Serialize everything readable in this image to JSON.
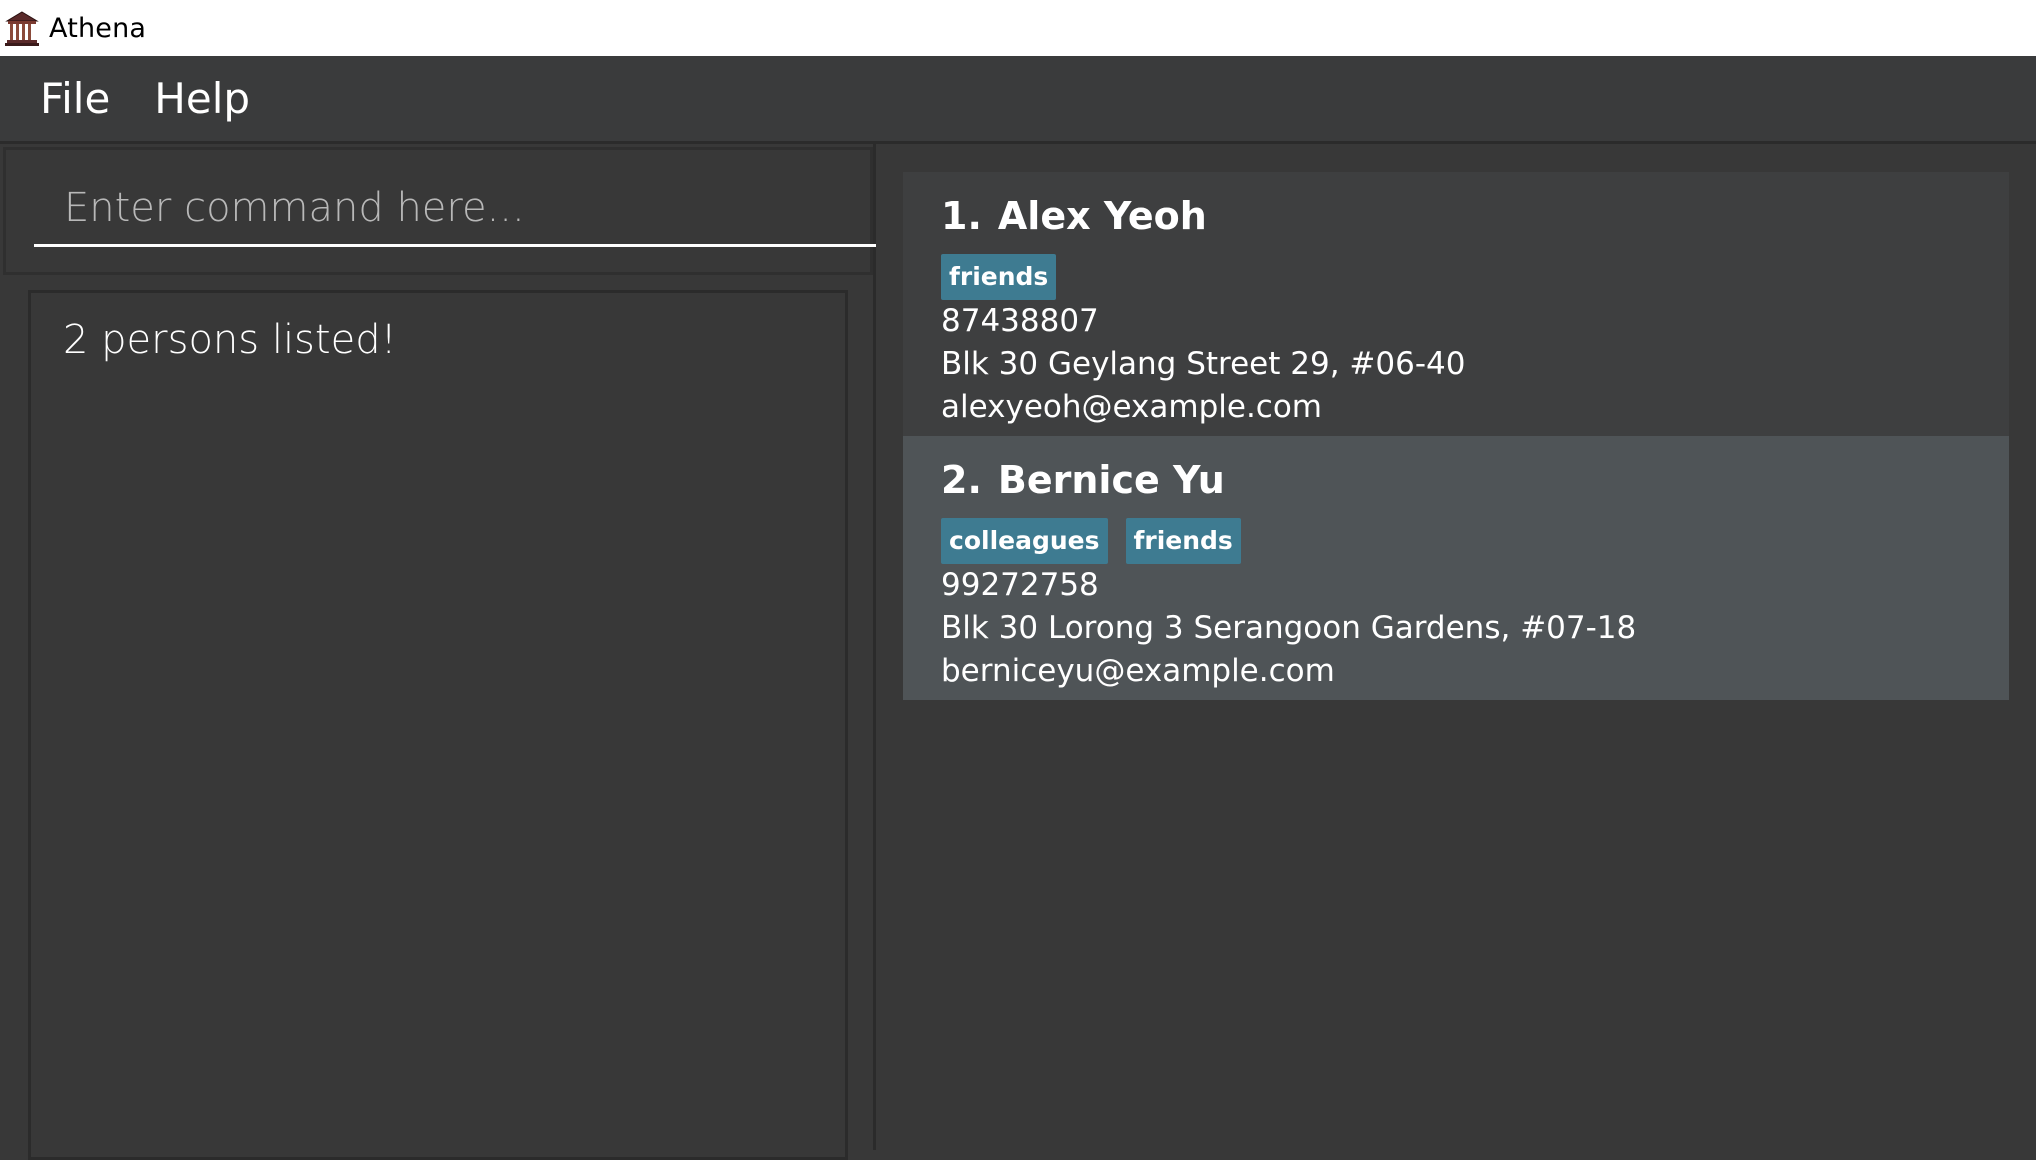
{
  "window": {
    "title": "Athena",
    "icon": "temple-icon"
  },
  "menu": {
    "items": [
      {
        "label": "File"
      },
      {
        "label": "Help"
      }
    ]
  },
  "command": {
    "placeholder": "Enter command here...",
    "value": ""
  },
  "result": {
    "text": "2 persons listed!"
  },
  "persons": [
    {
      "index": "1.",
      "name": "Alex Yeoh",
      "tags": [
        "friends"
      ],
      "phone": "87438807",
      "address": "Blk 30 Geylang Street 29, #06-40",
      "email": "alexyeoh@example.com"
    },
    {
      "index": "2.",
      "name": "Bernice Yu",
      "tags": [
        "colleagues",
        "friends"
      ],
      "phone": "99272758",
      "address": "Blk 30 Lorong 3 Serangoon Gardens, #07-18",
      "email": "berniceyu@example.com"
    }
  ],
  "colors": {
    "background": "#383838",
    "menubar": "#3a3b3c",
    "card_odd": "#3e3f40",
    "card_even": "#4f5457",
    "tag": "#3e7b91",
    "text": "#ffffff"
  }
}
